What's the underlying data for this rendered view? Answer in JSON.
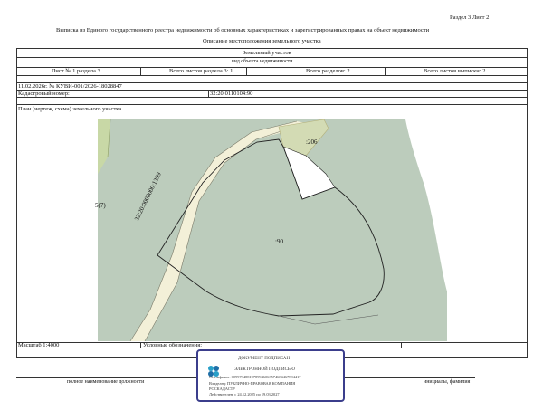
{
  "header": {
    "section_sheet": "Раздел 3    Лист 2",
    "title": "Выписка из Единого государственного реестра недвижимости об основных характеристиках и зарегистрированных правах на объект недвижимости",
    "subtitle": "Описание местоположения земельного участка"
  },
  "table": {
    "object_type": "Земельный участок",
    "object_kind_label": "вид объекта недвижимости",
    "sheet_of_section": "Лист № 1 раздела 3",
    "total_sheets_section": "Всего листов раздела 3: 1",
    "total_sections": "Всего разделов: 2",
    "total_sheets_extract": "Всего листов выписки: 2",
    "date_number": "11.02.2026г. № КУВИ-001/2026-18028847",
    "cadastral_label": "Кадастровый номер:",
    "cadastral_number": "32:20:0110104:90",
    "plan_label": "План (чертеж, схема) земельного участка"
  },
  "map": {
    "road_label": "32:20:0000000:1399",
    "parcel_label": ":90",
    "neighbor_label": ":206",
    "left_label": "5(7)",
    "colors": {
      "parcel_fill": "#bcccbc",
      "road_fill": "#f3f0d8",
      "field_fill": "#c8d8a6",
      "outline": "#222222"
    }
  },
  "footer": {
    "scale": "Масштаб 1:4000",
    "legend_label": "Условные обозначения:",
    "position_label": "полное наименование должности",
    "initials_label": "инициалы, фамилия"
  },
  "stamp": {
    "line1": "ДОКУМЕНТ ПОДПИСАН",
    "line2": "ЭЛЕКТРОННОЙ ПОДПИСЬЮ",
    "cert": "Сертификат: 00997348819789946063574684467894417",
    "owner": "Владелец: ПУБЛИЧНО-ПРАВОВАЯ КОМПАНИЯ",
    "owner2": "РОСКАДАСТР",
    "valid": "Действителен: с 24.12.2025 по 19.03.2027",
    "border_color": "#3b3e8c"
  }
}
